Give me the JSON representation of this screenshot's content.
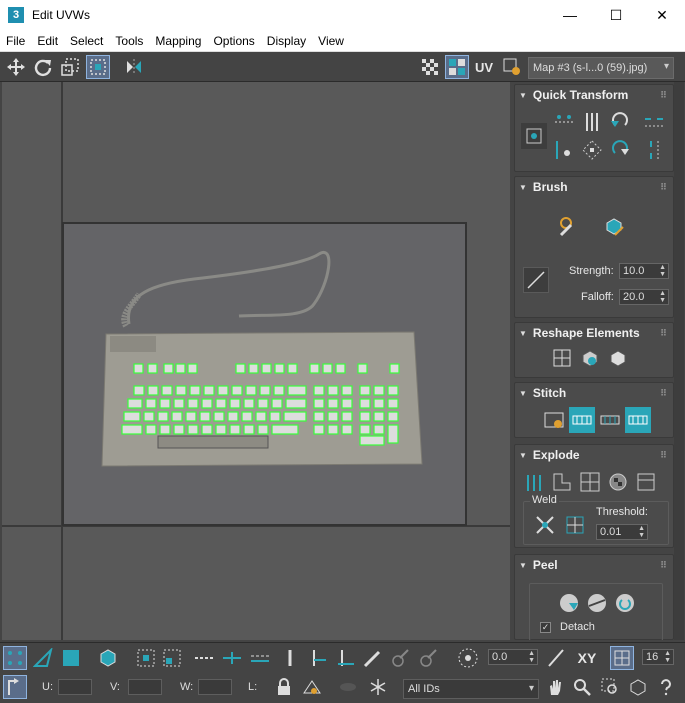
{
  "window": {
    "app_icon_text": "3",
    "title": "Edit UVWs",
    "minimize": "—",
    "maximize": "☐",
    "close": "✕"
  },
  "menu": [
    "File",
    "Edit",
    "Select",
    "Tools",
    "Mapping",
    "Options",
    "Display",
    "View"
  ],
  "toolbar": {
    "uv_label": "UV",
    "map_select": "Map #3 (s-l...0 (59).jpg)"
  },
  "panel": {
    "quick_transform": "Quick Transform",
    "brush": "Brush",
    "strength_label": "Strength:",
    "strength_value": "10.0",
    "falloff_label": "Falloff:",
    "falloff_value": "20.0",
    "reshape": "Reshape Elements",
    "stitch": "Stitch",
    "explode": "Explode",
    "weld_label": "Weld",
    "threshold_label": "Threshold:",
    "threshold_value": "0.01",
    "peel": "Peel",
    "detach_label": "Detach"
  },
  "bottom": {
    "angle_value": "0.0",
    "xy_label": "XY",
    "grid_value": "16",
    "u_label": "U:",
    "v_label": "V:",
    "w_label": "W:",
    "l_label": "L:",
    "ids_select": "All IDs"
  },
  "colors": {
    "accent_cyan": "#2aa6b8",
    "selection_green": "#39ff3a",
    "active_border": "#8fb4e0"
  }
}
